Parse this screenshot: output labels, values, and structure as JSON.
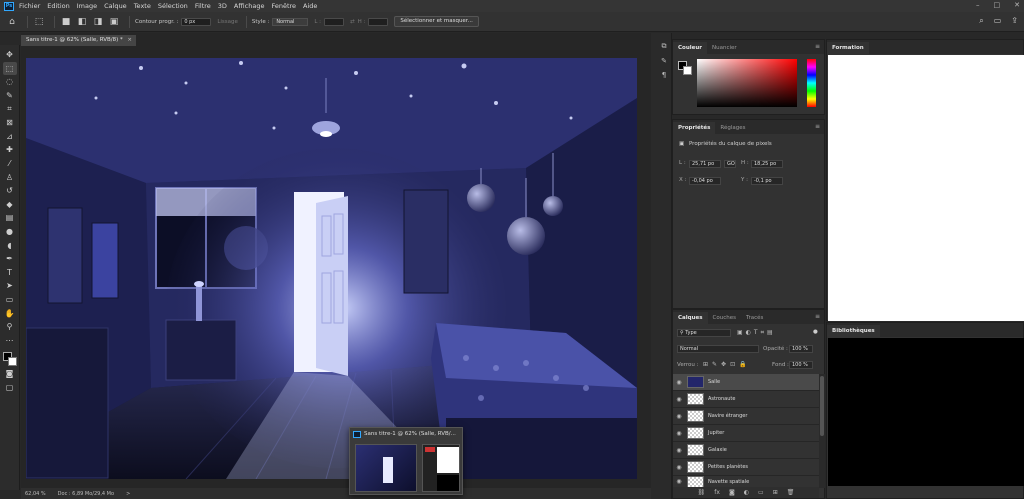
{
  "menubar": {
    "items": [
      "Fichier",
      "Edition",
      "Image",
      "Calque",
      "Texte",
      "Sélection",
      "Filtre",
      "3D",
      "Affichage",
      "Fenêtre",
      "Aide"
    ]
  },
  "options": {
    "contour_label": "Contour progr. :",
    "contour_value": "0 px",
    "lissage_label": "Lissage",
    "style_label": "Style :",
    "style_value": "Normal",
    "width_label": "L :",
    "height_label": "H :",
    "select_mask_button": "Sélectionner et masquer..."
  },
  "document": {
    "tab_title": "Sans titre-1 @ 62% (Salle, RVB/8) *",
    "status_zoom": "62,04 %",
    "status_doc": "Doc : 6,89 Mo/29,4 Mo",
    "status_arrow": ">",
    "popup_title": "Sans titre-1 @ 62% (Salle, RVB/..."
  },
  "color_panel": {
    "tabs": [
      "Couleur",
      "Nuancier"
    ]
  },
  "properties_panel": {
    "tabs": [
      "Propriétés",
      "Réglages"
    ],
    "subtitle": "Propriétés du calque de pixels",
    "w_label": "L :",
    "w_value": "25,71 po",
    "link_label": "GO",
    "h_label": "H :",
    "h_value": "18,25 po",
    "x_label": "X :",
    "x_value": "-0,04 po",
    "y_label": "Y :",
    "y_value": "-0,1 po"
  },
  "layers_panel": {
    "tabs": [
      "Calques",
      "Couches",
      "Tracés"
    ],
    "filter_label": "Type",
    "blend_mode": "Normal",
    "opacity_label": "Opacité :",
    "opacity_value": "100 %",
    "lock_label": "Verrou :",
    "fill_label": "Fond :",
    "fill_value": "100 %",
    "layers": [
      {
        "name": "Salle",
        "selected": true
      },
      {
        "name": "Astronaute",
        "selected": false
      },
      {
        "name": "Navire étranger",
        "selected": false
      },
      {
        "name": "Jupiter",
        "selected": false
      },
      {
        "name": "Galaxie",
        "selected": false
      },
      {
        "name": "Petites planètes",
        "selected": false
      },
      {
        "name": "Navette spatiale",
        "selected": false
      }
    ]
  },
  "formation_panel": {
    "title": "Formation"
  },
  "biblio_panel": {
    "title": "Bibliothèques"
  },
  "colors": {
    "app_bg": "#282828",
    "panel_bg": "#323232",
    "accent": "#31a8ff"
  }
}
